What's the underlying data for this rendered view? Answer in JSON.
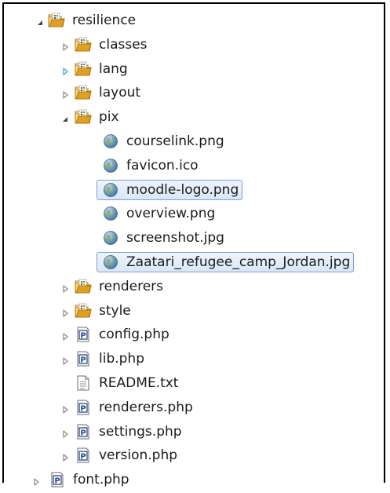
{
  "tree": [
    {
      "label": "resilience",
      "icon": "folder-icon",
      "expander": "expanded",
      "depth": 0
    },
    {
      "label": "classes",
      "icon": "folder-icon",
      "expander": "collapsed",
      "depth": 1
    },
    {
      "label": "lang",
      "icon": "folder-icon",
      "expander": "collapsed-hover",
      "depth": 1
    },
    {
      "label": "layout",
      "icon": "folder-icon",
      "expander": "collapsed",
      "depth": 1
    },
    {
      "label": "pix",
      "icon": "folder-icon",
      "expander": "expanded",
      "depth": 1
    },
    {
      "label": "courselink.png",
      "icon": "globe-file-icon",
      "expander": "none",
      "depth": 2
    },
    {
      "label": "favicon.ico",
      "icon": "globe-file-icon",
      "expander": "none",
      "depth": 2
    },
    {
      "label": "moodle-logo.png",
      "icon": "globe-file-icon",
      "expander": "none",
      "depth": 2,
      "selected": true
    },
    {
      "label": "overview.png",
      "icon": "globe-file-icon",
      "expander": "none",
      "depth": 2
    },
    {
      "label": "screenshot.jpg",
      "icon": "globe-file-icon",
      "expander": "none",
      "depth": 2
    },
    {
      "label": "Zaatari_refugee_camp_Jordan.jpg",
      "icon": "globe-file-icon",
      "expander": "none",
      "depth": 2,
      "selected": true
    },
    {
      "label": "renderers",
      "icon": "folder-icon",
      "expander": "collapsed",
      "depth": 1
    },
    {
      "label": "style",
      "icon": "folder-icon",
      "expander": "collapsed",
      "depth": 1
    },
    {
      "label": "config.php",
      "icon": "php-file-icon",
      "expander": "collapsed",
      "depth": 1
    },
    {
      "label": "lib.php",
      "icon": "php-file-icon",
      "expander": "collapsed",
      "depth": 1
    },
    {
      "label": "README.txt",
      "icon": "text-file-icon",
      "expander": "none",
      "depth": 1
    },
    {
      "label": "renderers.php",
      "icon": "php-file-icon",
      "expander": "collapsed",
      "depth": 1
    },
    {
      "label": "settings.php",
      "icon": "php-file-icon",
      "expander": "collapsed",
      "depth": 1
    },
    {
      "label": "version.php",
      "icon": "php-file-icon",
      "expander": "collapsed",
      "depth": 1
    },
    {
      "label": "font.php",
      "icon": "php-file-icon",
      "expander": "collapsed",
      "depth": 0,
      "outside": true
    }
  ],
  "colors": {
    "folder": "#e0a020",
    "folder_light": "#f7d47a",
    "globe": "#4a7fa8",
    "php": "#2a4b8c",
    "selection_border": "#7da2ce",
    "hover_arrow": "#39a5e6"
  },
  "php_icon_letter": "P"
}
